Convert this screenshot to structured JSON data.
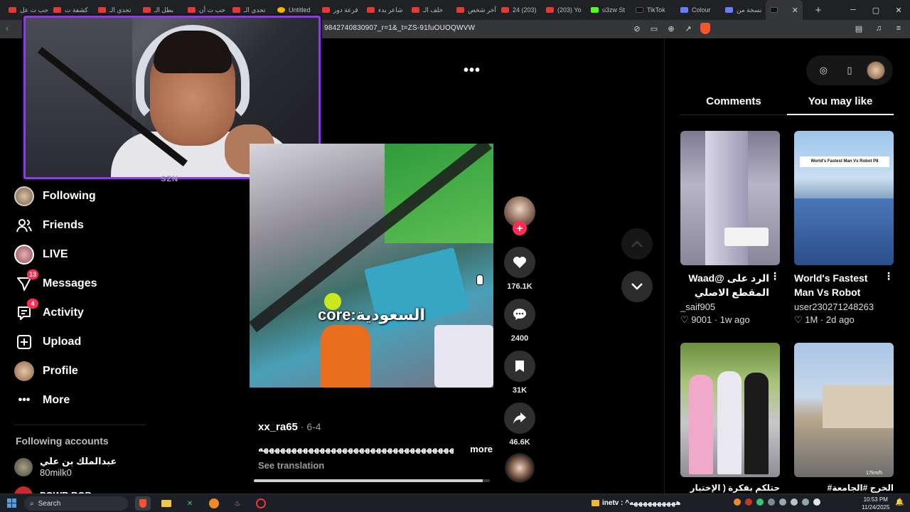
{
  "browser": {
    "tabs": [
      {
        "label": "حب ت عل",
        "fav": "yt"
      },
      {
        "label": "كشفة ت",
        "fav": "yt"
      },
      {
        "label": "تحدي الـ",
        "fav": "yt"
      },
      {
        "label": "بطل الـ",
        "fav": "yt"
      },
      {
        "label": "حب ت أن",
        "fav": "yt"
      },
      {
        "label": "تحدي الـ",
        "fav": "yt"
      },
      {
        "label": "Untitled",
        "fav": "un"
      },
      {
        "label": "قرعة دور",
        "fav": "yt"
      },
      {
        "label": "شاعر بدء",
        "fav": "yt"
      },
      {
        "label": "خلف الـ",
        "fav": "yt"
      },
      {
        "label": "آخر شخص",
        "fav": "yt"
      },
      {
        "label": "24 (203)",
        "fav": "yt"
      },
      {
        "label": "(203) Yo",
        "fav": "yt"
      },
      {
        "label": "u3zw St",
        "fav": "kk"
      },
      {
        "label": "TikTok",
        "fav": "tk"
      },
      {
        "label": "Colour",
        "fav": "co"
      },
      {
        "label": "نسخة من",
        "fav": "co"
      }
    ],
    "active_tab_close": "✕",
    "new_tab": "+",
    "url": "9842740830907_r=1&_t=ZS-91fuOUOQWVW",
    "window_controls": {
      "minimize": "─",
      "maximize": "▢",
      "close": "✕"
    }
  },
  "webcam": {
    "tag": "SZN"
  },
  "sidebar": {
    "items": [
      {
        "label": "Following",
        "icon": "following-avatar",
        "badge": ""
      },
      {
        "label": "Friends",
        "icon": "friends-icon",
        "badge": ""
      },
      {
        "label": "LIVE",
        "icon": "live-avatar",
        "badge": ""
      },
      {
        "label": "Messages",
        "icon": "messages-icon",
        "badge": "13"
      },
      {
        "label": "Activity",
        "icon": "activity-icon",
        "badge": "4"
      },
      {
        "label": "Upload",
        "icon": "upload-icon",
        "badge": ""
      },
      {
        "label": "Profile",
        "icon": "profile-avatar",
        "badge": ""
      },
      {
        "label": "More",
        "icon": "more-icon",
        "badge": ""
      }
    ],
    "following_accounts_title": "Following accounts",
    "following_accounts": [
      {
        "name": "عبدالملك بن علي",
        "handle": "80milk0"
      },
      {
        "name": "POWR ROB",
        "handle": ""
      }
    ]
  },
  "video": {
    "caption_overlay": "core:السعودية",
    "author": "xx_ra65",
    "date": " · 6-4",
    "description": "ههههههههههههههههههههههههههههههههههههههههههههههه",
    "more_label": "more",
    "translate_label": "See translation",
    "progress": 0.97
  },
  "actions": {
    "likes": "176.1K",
    "comments": "2400",
    "saves": "31K",
    "shares": "46.6K"
  },
  "right_panel": {
    "tabs": [
      "Comments",
      "You may like"
    ],
    "selected_tab": "You may like",
    "cards": [
      {
        "title": "الرد على @Waad المقطع الاصلي 🤫...",
        "user": "_saif905",
        "likes": "9001",
        "age": "1w ago"
      },
      {
        "title": "World's Fastest Man Vs Robot",
        "user": "user230271248263",
        "likes": "1M",
        "age": "2d ago",
        "thumb_banner": "World's Fastest Man Vs Robot P8"
      },
      {
        "title": "حتلكم بفكرة ( الإختبار",
        "user": "",
        "likes": "",
        "age": ""
      },
      {
        "title": "الخرج #الجامعة#",
        "user": "",
        "likes": "",
        "age": "",
        "thumb_overlay": "17km/h"
      }
    ]
  },
  "taskbar": {
    "search_label": "Search",
    "ticker": "inetv : ^ههههههههههه",
    "time": "10:53 PM",
    "date": "11/24/2025"
  },
  "colors": {
    "accent": "#fe2c55",
    "webcam_border": "#8a3ee0",
    "background": "#000000"
  }
}
